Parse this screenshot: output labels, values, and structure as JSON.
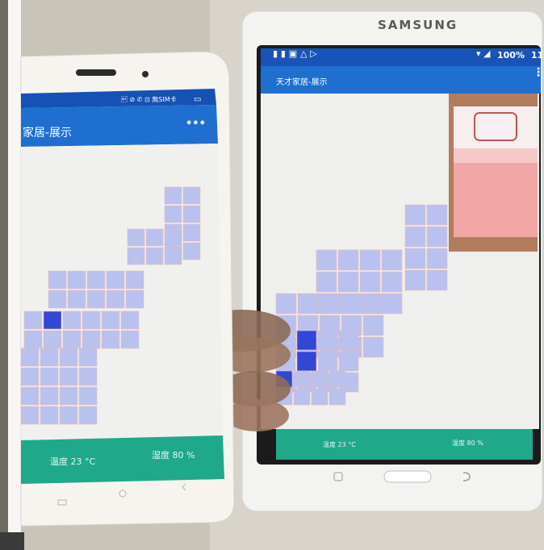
{
  "phone": {
    "status_text": "\b ⊘ ✆ ⊡ 無SIM卡",
    "app_title": "家居-展示",
    "menu_glyph": "•••",
    "temperature_text": "温度 23 °C",
    "humidity_text": "湿度 80 %"
  },
  "tablet": {
    "brand": "SAMSUNG",
    "status_text": "100%",
    "clock_fragment": "11",
    "app_title": "天才家居-展示",
    "menu_glyph": "⋮",
    "temperature_text": "温度 23 °C",
    "humidity_text": "湿度 80 %"
  },
  "colors": {
    "app_bar": "#1f6fd0",
    "footer": "#1fa98a",
    "tile": "#b9c2ee",
    "tile_active": "#3347d6",
    "grid_line_pink": "#f0b6b6",
    "bed_pink": "#f2a7a6",
    "bed_frame": "#b07b5b"
  }
}
